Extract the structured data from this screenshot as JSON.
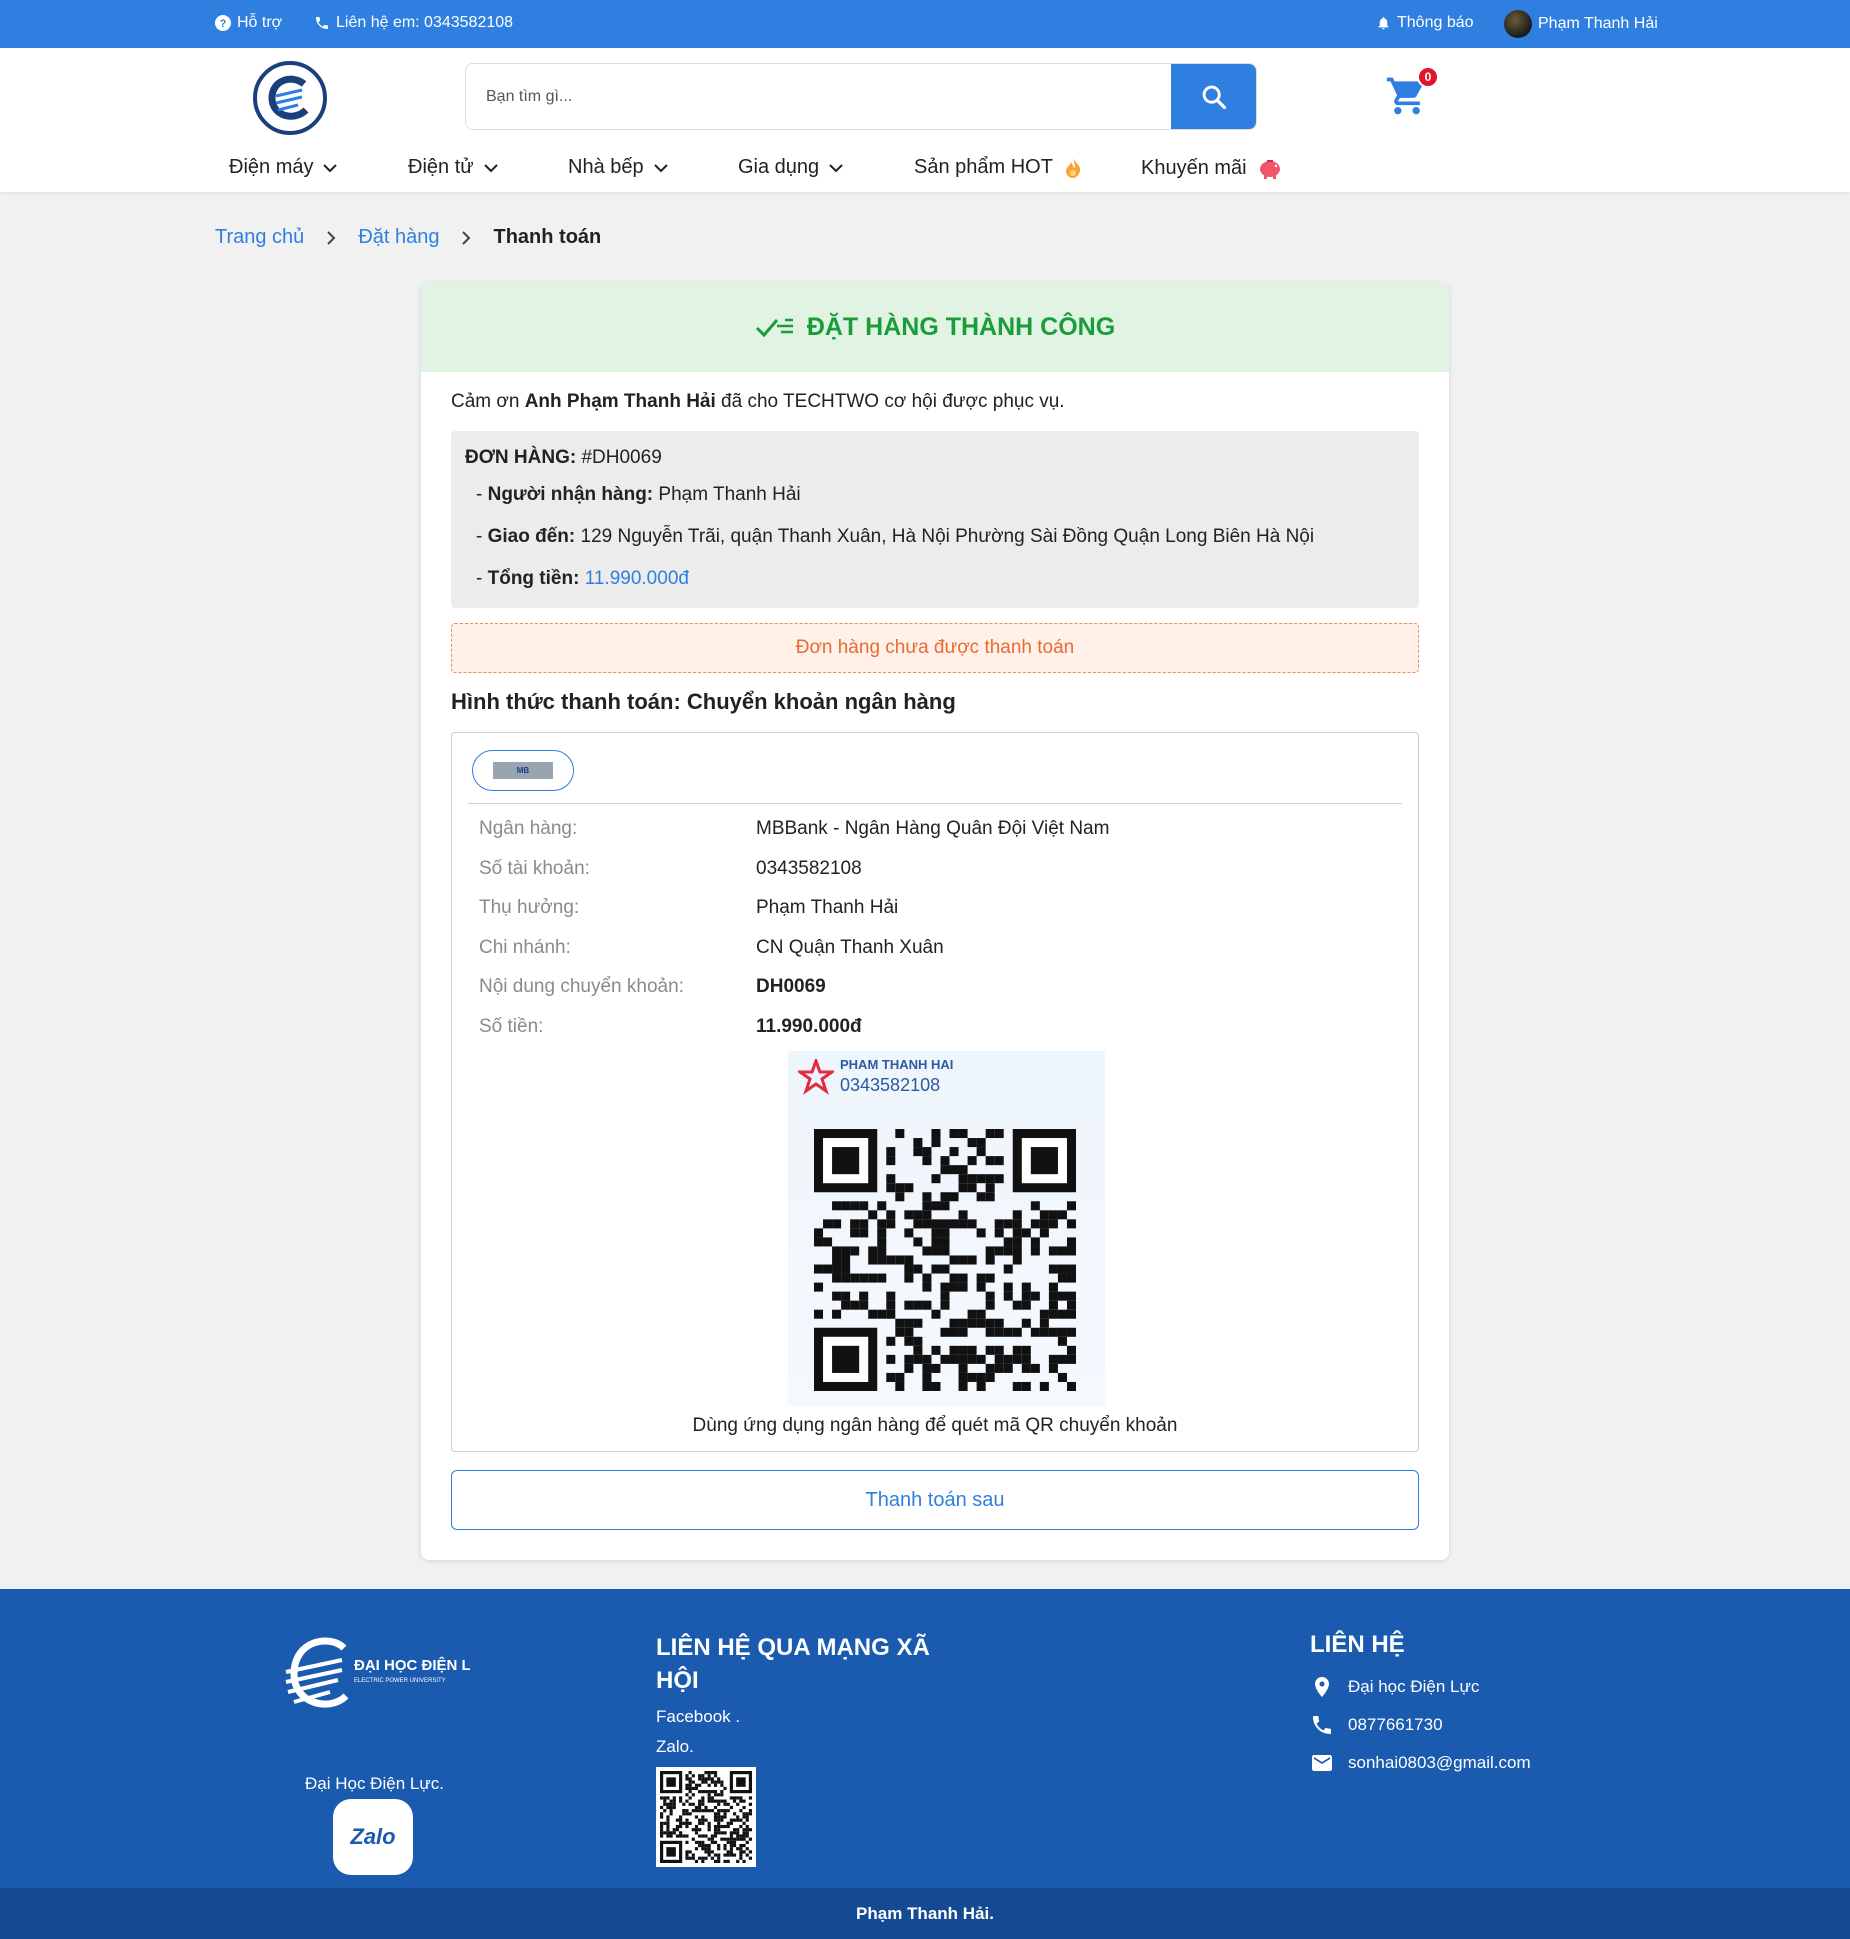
{
  "topbar": {
    "support": "Hỗ trợ",
    "contact": "Liên hệ em: 0343582108",
    "notifications": "Thông báo",
    "user_name": "Phạm Thanh Hải"
  },
  "search": {
    "placeholder": "Bạn tìm gì..."
  },
  "cart": {
    "count": "0"
  },
  "nav": [
    {
      "label": "Điện máy"
    },
    {
      "label": "Điện tử"
    },
    {
      "label": "Nhà bếp"
    },
    {
      "label": "Gia dụng"
    },
    {
      "label": "Sản phẩm HOT"
    },
    {
      "label": "Khuyến mãi"
    }
  ],
  "breadcrumb": {
    "home": "Trang chủ",
    "order": "Đặt hàng",
    "current": "Thanh toán"
  },
  "success": {
    "title": "ĐẶT HÀNG THÀNH CÔNG"
  },
  "thanks": {
    "prefix": "Cảm ơn ",
    "name": "Anh Phạm Thanh Hải",
    "suffix": " đã cho TECHTWO cơ hội được phục vụ."
  },
  "order": {
    "label": "ĐƠN HÀNG:",
    "id": " #DH0069",
    "receiver_label": "Người nhận hàng:",
    "receiver": " Phạm Thanh Hải",
    "address_label": "Giao đến:",
    "address": " 129 Nguyễn Trãi, quận Thanh Xuân, Hà Nội Phường Sài Đồng Quận Long Biên Hà Nội",
    "total_label": "Tổng tiền:",
    "total": " 11.990.000đ"
  },
  "status": {
    "unpaid": "Đơn hàng chưa được thanh toán"
  },
  "payment": {
    "title": "Hình thức thanh toán: Chuyển khoản ngân hàng",
    "bank_chip": "MB",
    "rows": [
      {
        "key": "Ngân hàng:",
        "value": "MBBank - Ngân Hàng Quân Đội Việt Nam"
      },
      {
        "key": "Số tài khoản:",
        "value": "0343582108"
      },
      {
        "key": "Thụ hưởng:",
        "value": "Phạm Thanh Hải"
      },
      {
        "key": "Chi nhánh:",
        "value": "CN Quận Thanh Xuân"
      },
      {
        "key": "Nội dung chuyển khoản:",
        "value": "DH0069"
      },
      {
        "key": "Số tiền:",
        "value": "11.990.000đ"
      }
    ],
    "qr_name": "PHAM THANH HAI",
    "qr_account": "0343582108",
    "qr_note": "Dùng ứng dụng ngân hàng để quét mã QR chuyển khoản",
    "later_button": "Thanh toán sau"
  },
  "footer": {
    "logo_line1": "ĐẠI HỌC ĐIỆN LỰC",
    "logo_line2": "ELECTRIC POWER UNIVERSITY",
    "university": "Đại Học Điện Lực.",
    "zalo_label": "Zalo",
    "social_title": "LIÊN HỆ QUA MẠNG XÃ HỘI",
    "facebook": "Facebook .",
    "zalo": "Zalo.",
    "contact_title": "LIÊN HỆ",
    "address": "Đại học Điện Lực",
    "phone": "0877661730",
    "email": "sonhai0803@gmail.com",
    "copyright": "Phạm Thanh Hải."
  },
  "colors": {
    "primary": "#2f7fe0",
    "success": "#1a9c3a",
    "warning": "#ea6a35",
    "footer": "#1a5bb0"
  }
}
